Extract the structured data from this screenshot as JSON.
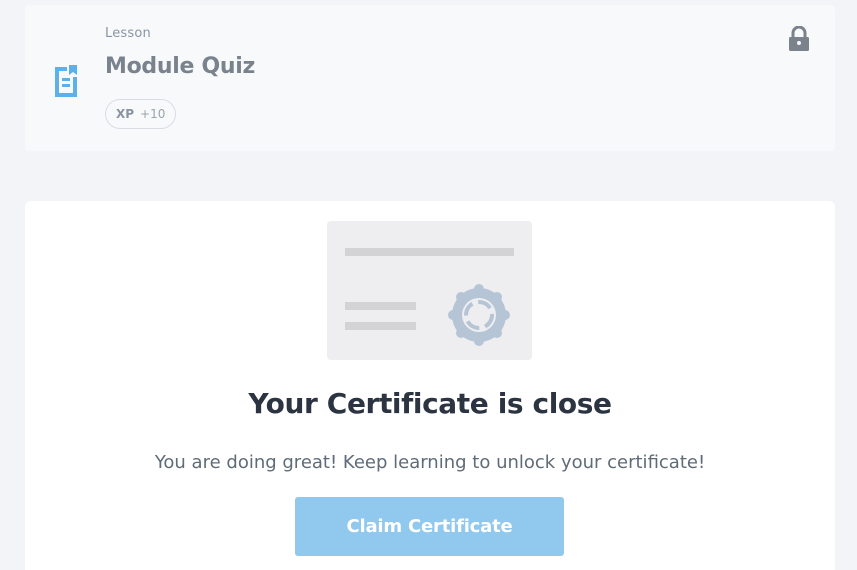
{
  "lesson": {
    "type_label": "Lesson",
    "title": "Module Quiz",
    "xp_label": "XP",
    "xp_value": "+10",
    "icon": "document-icon",
    "status_icon": "lock-icon"
  },
  "certificate": {
    "heading": "Your Certificate is close",
    "subtext": "You are doing great! Keep learning to unlock your certificate!",
    "button_label": "Claim Certificate",
    "illustration": "certificate-illustration"
  },
  "colors": {
    "accent": "#91c8ee",
    "icon_blue": "#5fb0e6",
    "lock_gray": "#7b828b",
    "page_bg": "#f2f4f7"
  }
}
